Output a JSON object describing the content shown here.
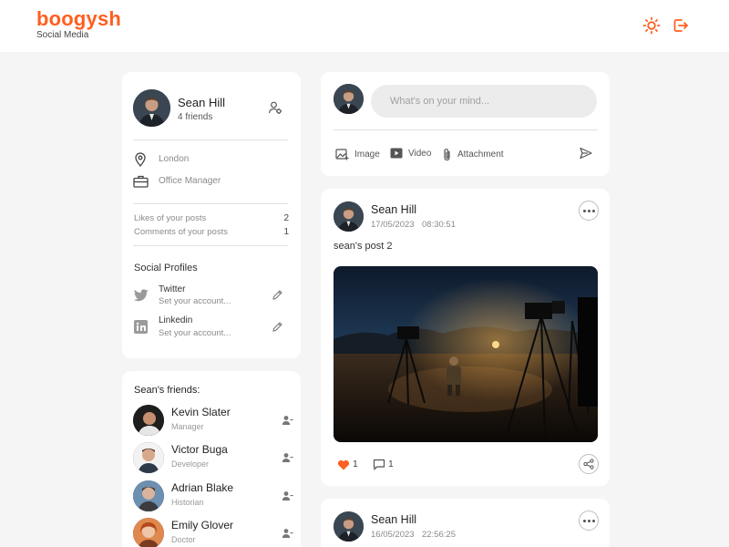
{
  "header": {
    "logo": "boogysh",
    "tagline": "Social Media",
    "theme_icon": "sun-icon",
    "logout_icon": "logout-icon",
    "accent_color": "#ff5f1f"
  },
  "profile": {
    "name": "Sean Hill",
    "friends_count": "4 friends",
    "location": "London",
    "occupation": "Office Manager",
    "stats": [
      {
        "label": "Likes of your posts",
        "value": "2"
      },
      {
        "label": "Comments of your posts",
        "value": "1"
      }
    ],
    "social_title": "Social Profiles",
    "socials": [
      {
        "name": "Twitter",
        "placeholder": "Set your account...",
        "icon": "twitter-icon"
      },
      {
        "name": "Linkedin",
        "placeholder": "Set your account...",
        "icon": "linkedin-icon"
      }
    ]
  },
  "friends": {
    "title": "Sean's friends:",
    "list": [
      {
        "name": "Kevin Slater",
        "role": "Manager"
      },
      {
        "name": "Victor Buga",
        "role": "Developer"
      },
      {
        "name": "Adrian Blake",
        "role": "Historian"
      },
      {
        "name": "Emily Glover",
        "role": "Doctor"
      }
    ]
  },
  "composer": {
    "placeholder": "What's on your mind...",
    "actions": [
      {
        "label": "Image",
        "icon": "image-add-icon"
      },
      {
        "label": "Video",
        "icon": "video-icon"
      },
      {
        "label": "Attachment",
        "icon": "paperclip-icon"
      }
    ],
    "send_icon": "send-icon"
  },
  "posts": [
    {
      "author": "Sean Hill",
      "date": "17/05/2023",
      "time": "08:30:51",
      "text": "sean's post 2",
      "likes": "1",
      "comments": "1"
    },
    {
      "author": "Sean Hill",
      "date": "16/05/2023",
      "time": "22:56:25"
    }
  ]
}
